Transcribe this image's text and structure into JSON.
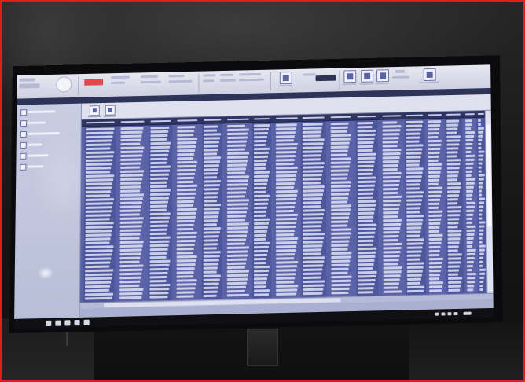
{
  "photo": {
    "subject": "",
    "frame_color": "#e41b1b"
  },
  "window": {
    "title": "",
    "ribbon_groups": [
      "",
      "",
      "",
      "",
      "",
      "",
      "",
      "",
      "",
      ""
    ],
    "toolbar_buttons": [
      "",
      ""
    ],
    "sidebar_items": [
      "",
      "",
      "",
      "",
      "",
      ""
    ]
  },
  "grid": {
    "column_headers": [
      "",
      "",
      "",
      "",
      "",
      "",
      "",
      "",
      "",
      "",
      "",
      "",
      "",
      "",
      "",
      "",
      ""
    ],
    "row_count_visible": 44,
    "status_text": ""
  },
  "colors": {
    "grid_background": "#5a62a6",
    "header_background": "#2f3562",
    "ribbon_background": "#e6e7f0",
    "sidebar_background": "#c9cde3",
    "accent_red": "#e24a4a"
  }
}
